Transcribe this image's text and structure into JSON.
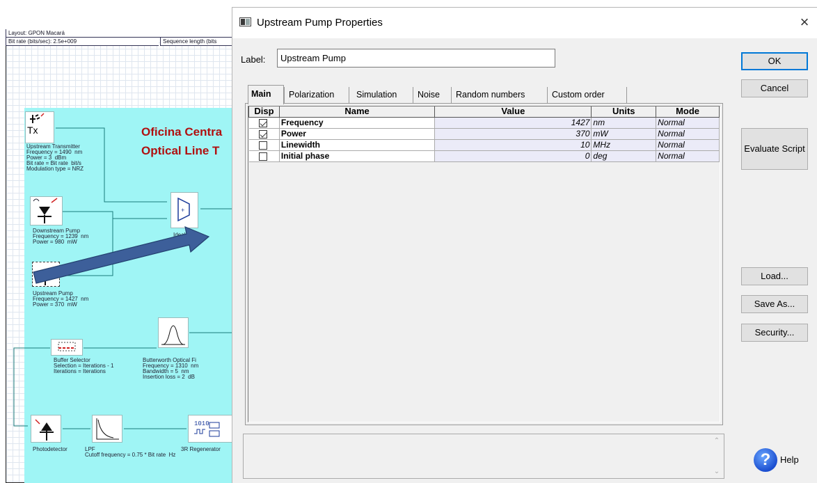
{
  "schematic": {
    "layout_title": "Layout: GPON Macará",
    "bit_rate": "Bit rate (bits/sec):  2.5e+009",
    "sequence_length": "Sequence length (bits",
    "heading_line1": "Oficina Centra",
    "heading_line2": "Optical Line T",
    "components": {
      "upstream_transmitter": {
        "icon_text": "Tx",
        "label": "Upstream Transmitter\nFrequency = 1490  nm\nPower = 3  dBm\nBit rate = Bit rate  bit/s\nModulation type = NRZ"
      },
      "downstream_pump": {
        "label": "Downstream Pump\nFrequency = 1239  nm\nPower = 980  mW"
      },
      "ideal_mux": {
        "label": "Ideal M"
      },
      "upstream_pump": {
        "label": "Upstream Pump\nFrequency = 1427  nm\nPower = 370  mW"
      },
      "buffer_selector": {
        "label": "Buffer Selector\nSelection = Iterations - 1\nIterations = Iterations"
      },
      "butterworth_filter": {
        "label": "Butterworth Optical Fi\nFrequency = 1310  nm\nBandwidth = 5  nm\nInsertion loss = 2  dB"
      },
      "photodetector": {
        "label": "Photodetector"
      },
      "lpf": {
        "label": "LPF\nCutoff frequency = 0.75 * Bit rate  Hz"
      },
      "regenerator": {
        "label": "3R Regenerator"
      }
    }
  },
  "dialog": {
    "title": "Upstream Pump Properties",
    "close_glyph": "×",
    "label_caption": "Label:",
    "label_value": "Upstream Pump",
    "tabs": [
      "Main",
      "Polarization",
      "Simulation",
      "Noise",
      "Random numbers",
      "Custom order"
    ],
    "table": {
      "headers": [
        "Disp",
        "Name",
        "Value",
        "Units",
        "Mode"
      ],
      "rows": [
        {
          "disp": true,
          "name": "Frequency",
          "value": "1427",
          "units": "nm",
          "mode": "Normal"
        },
        {
          "disp": true,
          "name": "Power",
          "value": "370",
          "units": "mW",
          "mode": "Normal"
        },
        {
          "disp": false,
          "name": "Linewidth",
          "value": "10",
          "units": "MHz",
          "mode": "Normal"
        },
        {
          "disp": false,
          "name": "Initial phase",
          "value": "0",
          "units": "deg",
          "mode": "Normal"
        }
      ]
    },
    "buttons": {
      "ok": "OK",
      "cancel": "Cancel",
      "evaluate_script": "Evaluate Script",
      "load": "Load...",
      "save_as": "Save As...",
      "security": "Security...",
      "help": "Help"
    },
    "scroll_up_glyph": "⌃",
    "scroll_down_glyph": "⌄"
  },
  "colors": {
    "canvas_cyan": "#9ff5f5",
    "heading_red": "#b01010",
    "arrow_blue": "#3d5f9a",
    "default_button_border": "#0078d7"
  }
}
